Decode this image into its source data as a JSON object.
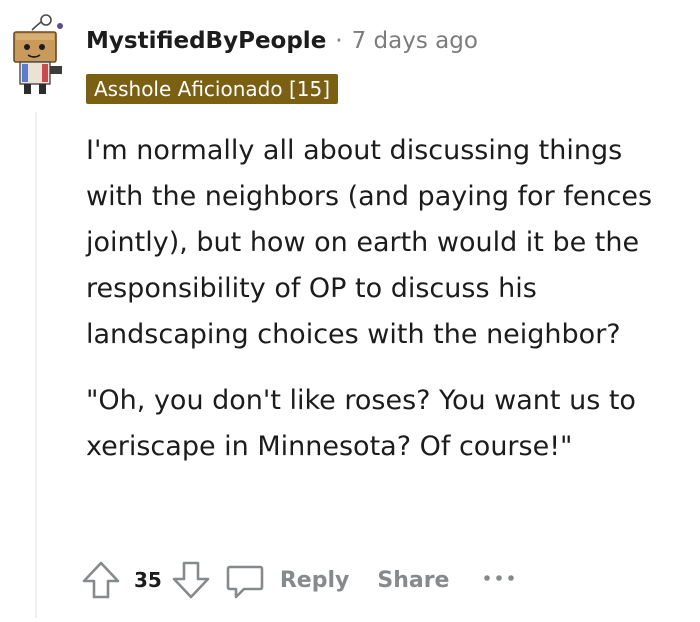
{
  "comment": {
    "author": "MystifiedByPeople",
    "separator": "·",
    "timestamp": "7 days ago",
    "flair": "Asshole Aficionado [15]",
    "paragraphs": [
      "I'm normally all about discussing things with the neighbors (and paying for fences jointly), but how on earth would it be the responsibility of OP to discuss his landscaping choices with the neighbor?",
      "\"Oh, you don't like roses? You want us to xeriscape in Minnesota? Of course!\""
    ]
  },
  "actions": {
    "vote_count": "35",
    "reply_label": "Reply",
    "share_label": "Share"
  },
  "colors": {
    "flair_background": "#7b5f12",
    "muted_text": "#878a8c"
  },
  "icons": [
    "avatar",
    "upvote-icon",
    "downvote-icon",
    "comment-bubble-icon",
    "more-options-icon"
  ]
}
